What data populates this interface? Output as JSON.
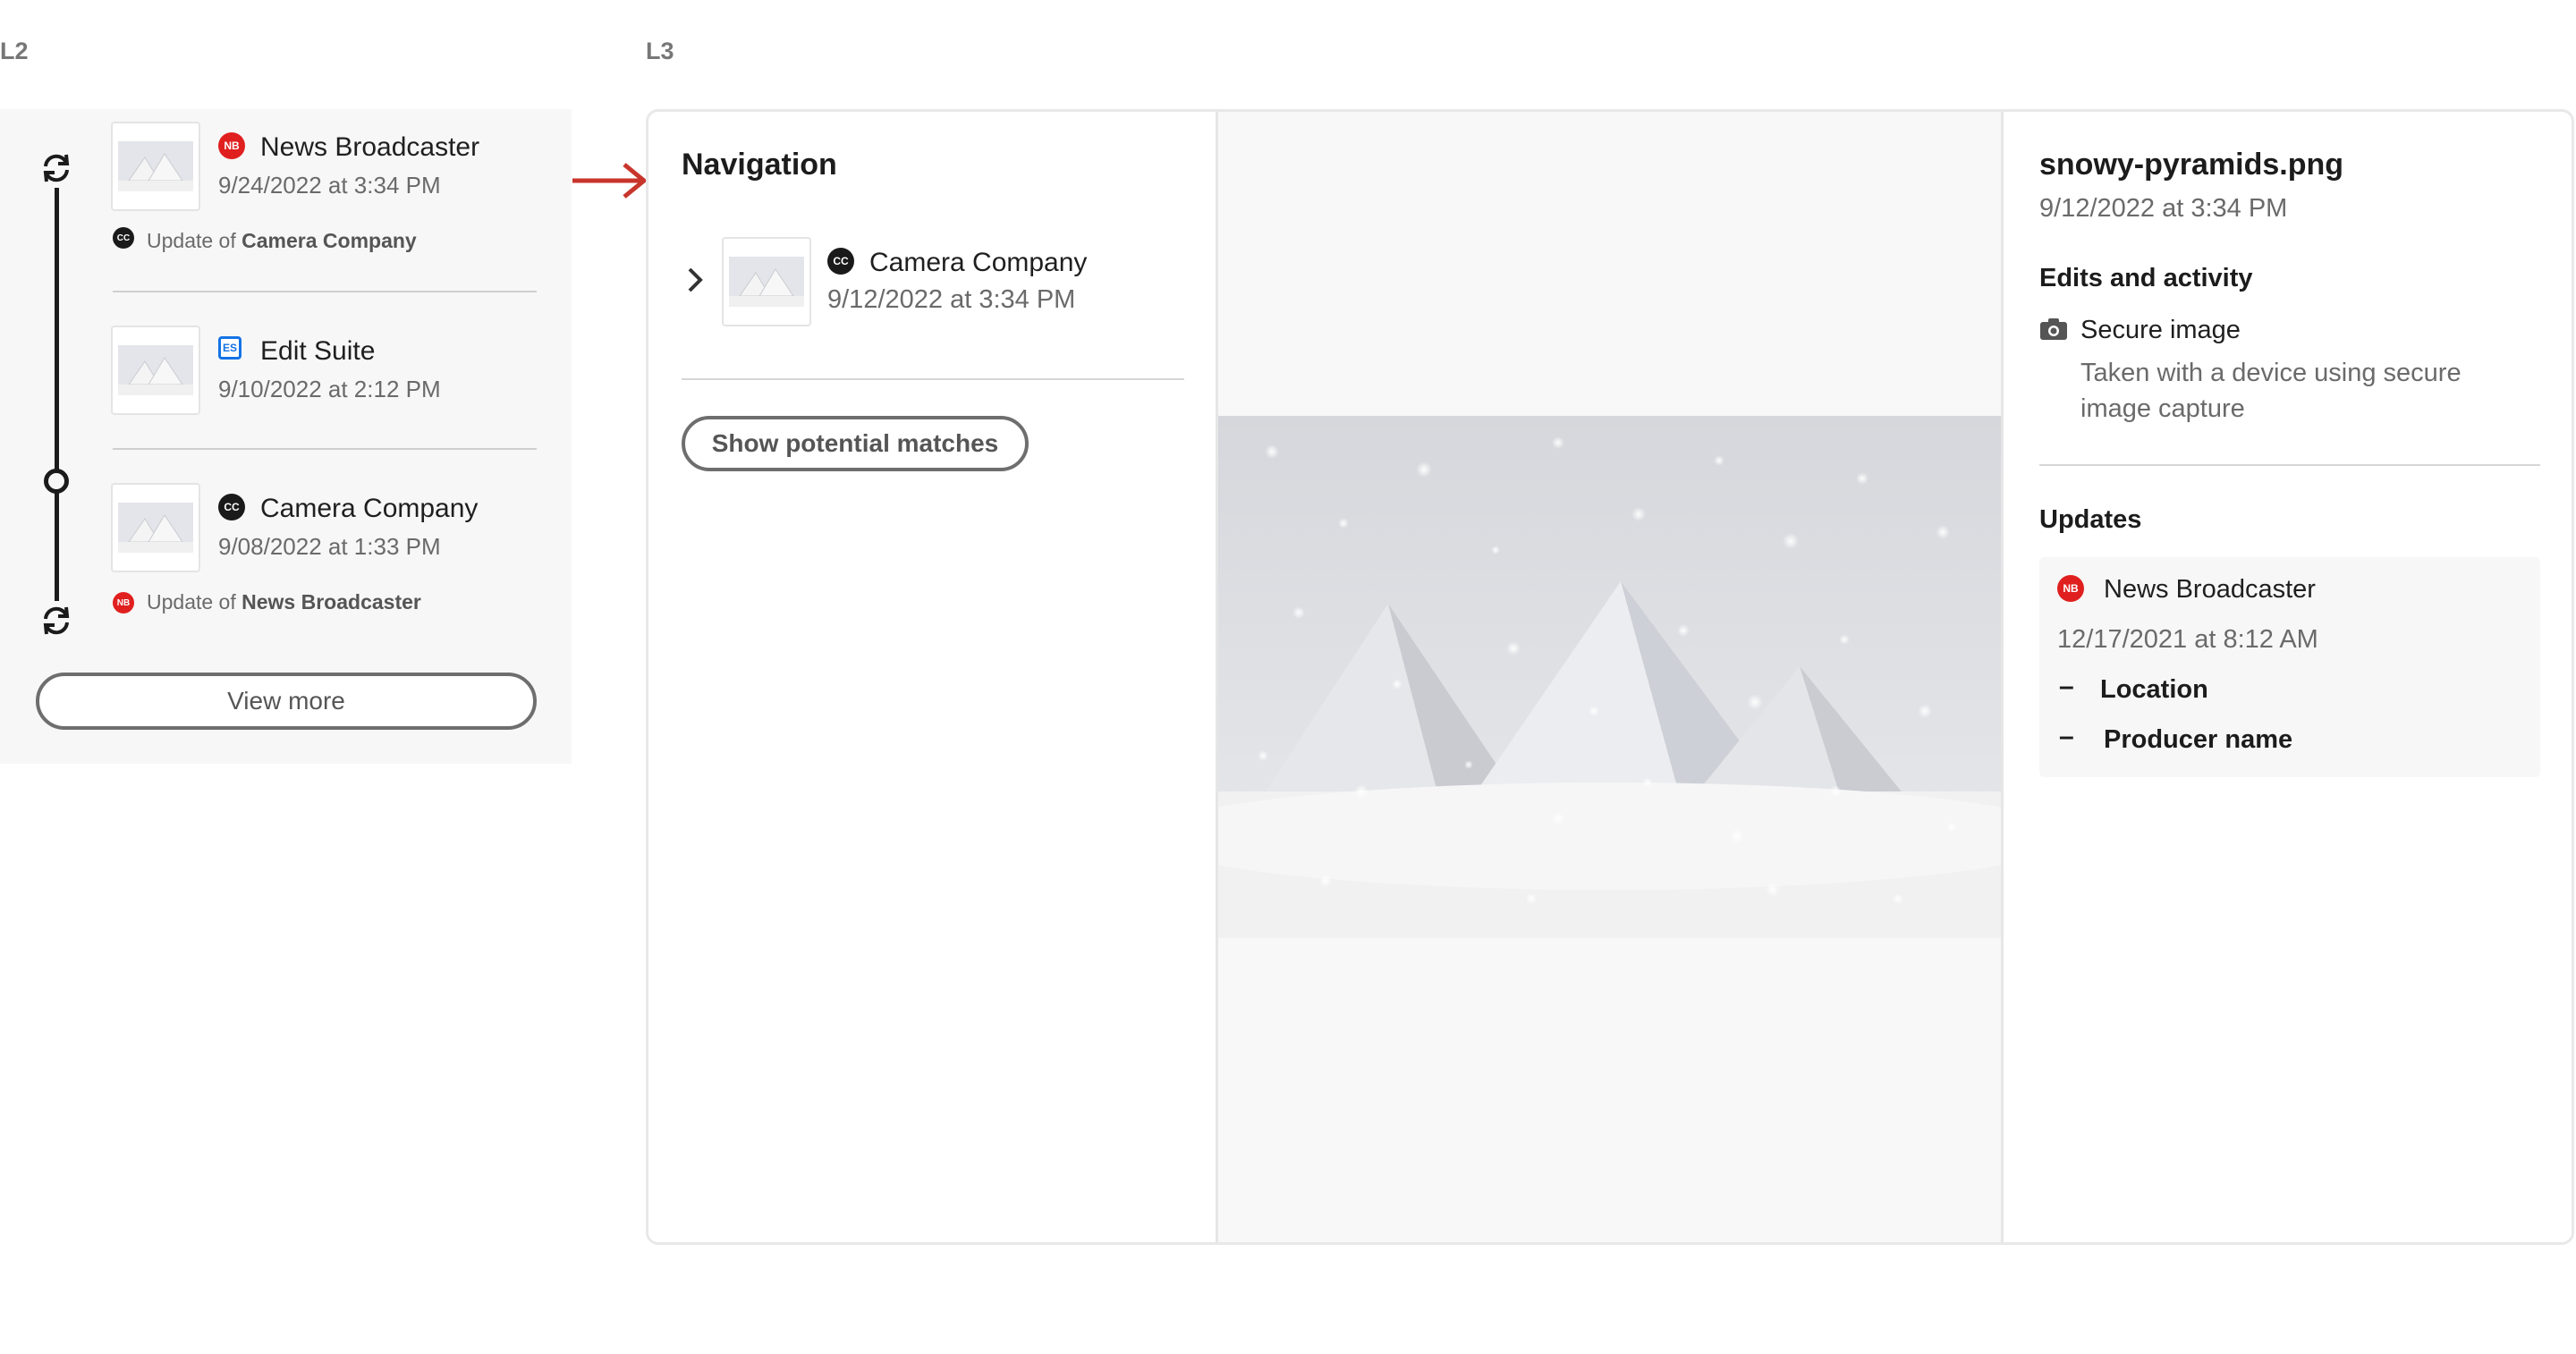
{
  "labels": {
    "l2": "L2",
    "l3": "L3"
  },
  "l2": {
    "items": [
      {
        "title": "News Broadcaster",
        "date": "9/24/2022 at 3:34 PM",
        "badge": "NB",
        "badge_icon": "news-broadcaster-badge",
        "note_prefix": "Update of",
        "note_org": "Camera Company",
        "note_badge": "CC"
      },
      {
        "title": "Edit Suite",
        "date": "9/10/2022 at 2:12 PM",
        "badge": "ES",
        "badge_icon": "edit-suite-badge"
      },
      {
        "title": "Camera Company",
        "date": "9/08/2022 at 1:33 PM",
        "badge": "CC",
        "badge_icon": "camera-company-badge",
        "note_prefix": "Update of",
        "note_org": "News Broadcaster",
        "note_badge": "NB"
      }
    ],
    "view_more": "View more"
  },
  "navigation": {
    "title": "Navigation",
    "item": {
      "title": "Camera Company",
      "date": "9/12/2022 at 3:34 PM",
      "badge": "CC"
    },
    "show_matches": "Show potential matches"
  },
  "details": {
    "filename": "snowy-pyramids.png",
    "date": "9/12/2022 at 3:34 PM",
    "edits_heading": "Edits and activity",
    "secure_title": "Secure image",
    "secure_desc_line1": "Taken with a device using secure",
    "secure_desc_line2": "image capture",
    "updates_heading": "Updates",
    "update": {
      "org": "News Broadcaster",
      "badge": "NB",
      "date": "12/17/2021 at 8:12 AM",
      "fields": [
        "Location",
        "Producer name"
      ]
    }
  },
  "colors": {
    "nb_red": "#e0201f",
    "cc_black": "#1a1a1a",
    "es_blue": "#1473e6",
    "arrow_red": "#c8352b"
  }
}
